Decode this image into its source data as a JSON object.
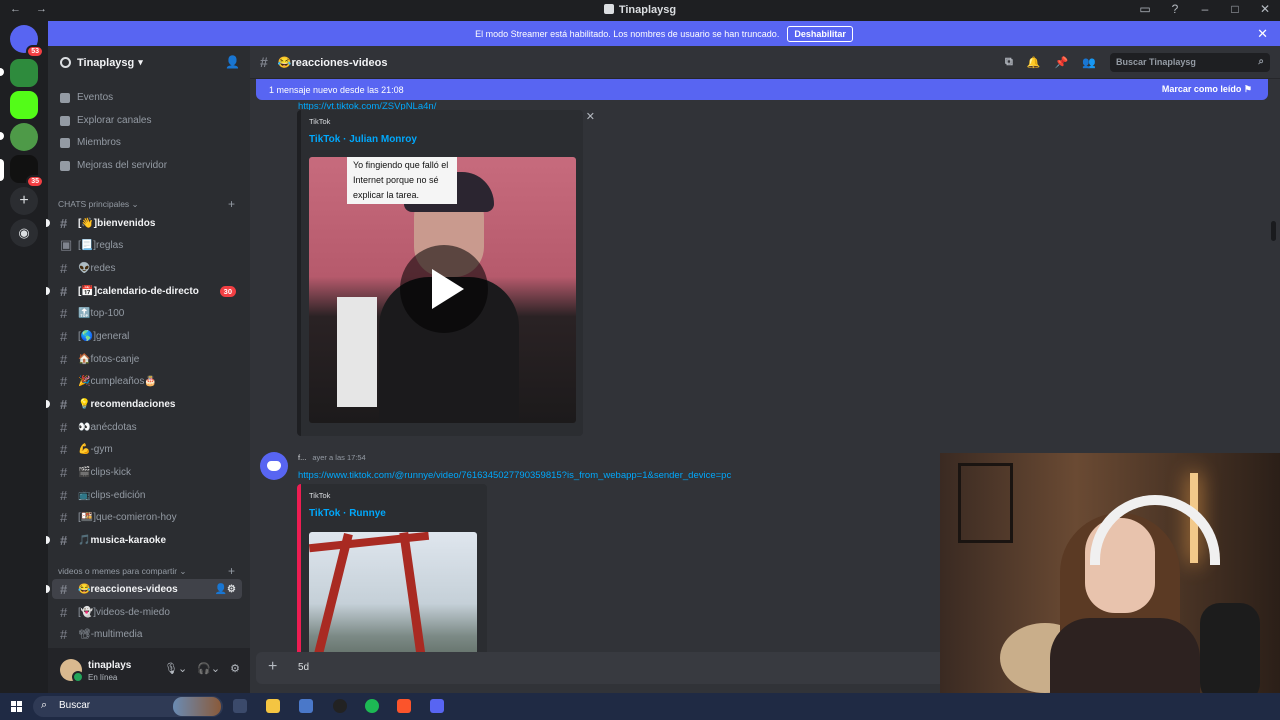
{
  "window": {
    "title": "Tinaplaysg",
    "nav": "← →"
  },
  "rail": {
    "badges": [
      "53",
      "35"
    ]
  },
  "banner": {
    "text": "El modo Streamer está habilitado. Los nombres de usuario se han truncado.",
    "button": "Deshabilitar"
  },
  "server": {
    "name": "Tinaplaysg",
    "top_items": [
      "Eventos",
      "Explorar canales",
      "Miembros",
      "Mejoras del servidor"
    ],
    "categories": [
      "CHATS principales",
      "videos o memes para compartir"
    ],
    "channels": [
      {
        "label": "[👋]bienvenidos",
        "state": "unread"
      },
      {
        "label": "[📃]reglas",
        "state": "read"
      },
      {
        "label": "👽redes",
        "state": "read"
      },
      {
        "label": "[📅]calendario-de-directo",
        "state": "unread",
        "mentions": "30"
      },
      {
        "label": "🔝top-100",
        "state": "read"
      },
      {
        "label": "[🌎]general",
        "state": "read"
      },
      {
        "label": "🏠fotos-canje",
        "state": "read"
      },
      {
        "label": "🎉cumpleaños🎂",
        "state": "read"
      },
      {
        "label": "💡recomendaciones",
        "state": "unread"
      },
      {
        "label": "👀anécdotas",
        "state": "read"
      },
      {
        "label": "💪-gym",
        "state": "read"
      },
      {
        "label": "🎬clips-kick",
        "state": "read"
      },
      {
        "label": "📺clips-edición",
        "state": "read"
      },
      {
        "label": "[🍱]que-comieron-hoy",
        "state": "read"
      },
      {
        "label": "🎵musica-karaoke",
        "state": "unread"
      },
      {
        "label": "😂reacciones-videos",
        "state": "active"
      },
      {
        "label": "[👻]videos-de-miedo",
        "state": "read"
      },
      {
        "label": "📽-multimedia",
        "state": "read"
      }
    ]
  },
  "user": {
    "name": "tinaplays",
    "status": "En línea"
  },
  "channel": {
    "name": "😂reacciones-videos",
    "search_placeholder": "Buscar Tinaplaysg",
    "new_messages": "1 mensaje nuevo desde las 21:08",
    "mark_read": "Marcar como leído"
  },
  "messages": [
    {
      "link": "https://vt.tiktok.com/ZSVpNLa4n/",
      "embed_provider": "TikTok",
      "embed_title": "TikTok · Julian Monroy",
      "video_caption": "Yo fingiendo que falló el Internet porque no sé explicar la tarea."
    },
    {
      "author": "f...",
      "timestamp": "ayer a las 17:54",
      "link": "https://www.tiktok.com/@runnye/video/7616345027790359815?is_from_webapp=1&sender_device=pc",
      "embed_provider": "TikTok",
      "embed_title": "TikTok · Runnye"
    }
  ],
  "composer": {
    "value": "5d"
  },
  "taskbar": {
    "search": "Buscar"
  },
  "icons": {
    "invite": "person-add-icon",
    "threads": "threads-icon",
    "bell": "bell-icon",
    "pin": "pin-icon",
    "members": "members-icon",
    "search": "search-icon"
  },
  "colors": {
    "blurple": "#5865f2",
    "mention_red": "#f23f43",
    "link_blue": "#00a8fc"
  }
}
